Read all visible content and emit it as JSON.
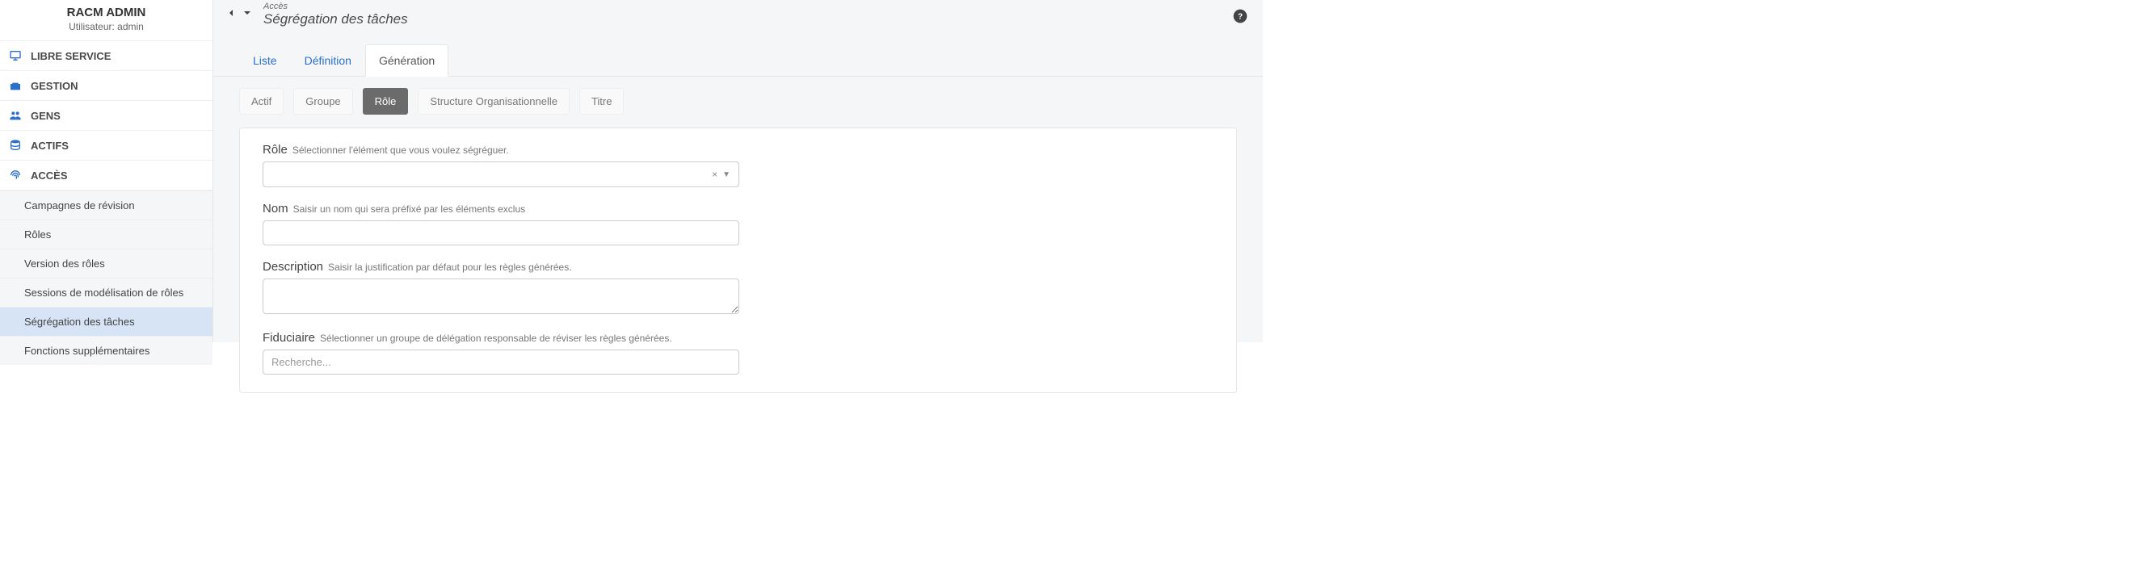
{
  "sidebar": {
    "title": "RACM ADMIN",
    "subtitle": "Utilisateur: admin",
    "items": [
      {
        "label": "LIBRE SERVICE",
        "icon": "monitor"
      },
      {
        "label": "GESTION",
        "icon": "toolbox"
      },
      {
        "label": "GENS",
        "icon": "people"
      },
      {
        "label": "ACTIFS",
        "icon": "database"
      },
      {
        "label": "ACCÈS",
        "icon": "fingerprint"
      }
    ],
    "sub_items": [
      {
        "label": "Campagnes de révision"
      },
      {
        "label": "Rôles"
      },
      {
        "label": "Version des rôles"
      },
      {
        "label": "Sessions de modélisation de rôles"
      },
      {
        "label": "Ségrégation des tâches"
      },
      {
        "label": "Fonctions supplémentaires"
      }
    ]
  },
  "header": {
    "breadcrumb_top": "Accès",
    "breadcrumb_bottom": "Ségrégation des tâches"
  },
  "tabs": [
    {
      "label": "Liste"
    },
    {
      "label": "Définition"
    },
    {
      "label": "Génération"
    }
  ],
  "pills": [
    {
      "label": "Actif"
    },
    {
      "label": "Groupe"
    },
    {
      "label": "Rôle"
    },
    {
      "label": "Structure Organisationnelle"
    },
    {
      "label": "Titre"
    }
  ],
  "form": {
    "role": {
      "label": "Rôle",
      "hint": "Sélectionner l'élément que vous voulez ségréguer.",
      "clear_glyph": "×",
      "caret_glyph": "▼"
    },
    "name": {
      "label": "Nom",
      "hint": "Saisir un nom qui sera préfixé par les éléments exclus",
      "value": ""
    },
    "description": {
      "label": "Description",
      "hint": "Saisir la justification par défaut pour les règles générées.",
      "value": ""
    },
    "fiduciaire": {
      "label": "Fiduciaire",
      "hint": "Sélectionner un groupe de délégation responsable de réviser les règles générées.",
      "placeholder": "Recherche..."
    }
  }
}
